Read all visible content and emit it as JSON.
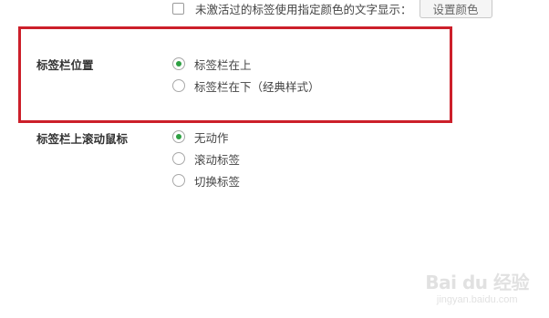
{
  "top_option": {
    "label": "未激活过的标签使用指定颜色的文字显示：",
    "button_label": "设置颜色"
  },
  "tab_bar_position": {
    "title": "标签栏位置",
    "options": [
      {
        "label": "标签栏在上",
        "selected": true
      },
      {
        "label": "标签栏在下（经典样式）",
        "selected": false
      }
    ]
  },
  "tab_bar_scroll": {
    "title": "标签栏上滚动鼠标",
    "options": [
      {
        "label": "无动作",
        "selected": true
      },
      {
        "label": "滚动标签",
        "selected": false
      },
      {
        "label": "切换标签",
        "selected": false
      }
    ]
  },
  "watermark": {
    "logo": "Bai du 经验",
    "url": "jingyan.baidu.com"
  },
  "colors": {
    "highlight": "#cc1f2a",
    "radio_selected": "#2ea043"
  }
}
